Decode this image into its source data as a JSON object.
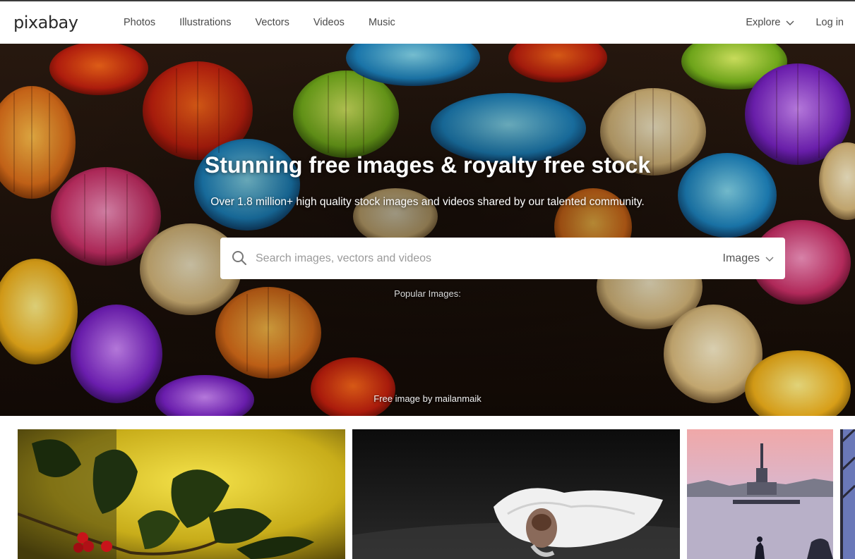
{
  "header": {
    "logo": "pixabay",
    "nav": [
      "Photos",
      "Illustrations",
      "Vectors",
      "Videos",
      "Music"
    ],
    "explore_label": "Explore",
    "login_label": "Log in"
  },
  "hero": {
    "title": "Stunning free images & royalty free stock",
    "subtitle": "Over 1.8 million+ high quality stock images and videos shared by our talented community.",
    "search": {
      "placeholder": "Search images, vectors and videos",
      "value": "",
      "type_label": "Images"
    },
    "popular_label": "Popular Images:",
    "credit": "Free image by mailanmaik"
  },
  "icons": {
    "search": "search-icon",
    "explore_chevron": "chevron-down-icon",
    "type_chevron": "chevron-down-icon"
  },
  "colors": {
    "accent_dark": "#2b2b2b",
    "nav_text": "#4a4a4a",
    "placeholder": "#9a9a9a"
  }
}
